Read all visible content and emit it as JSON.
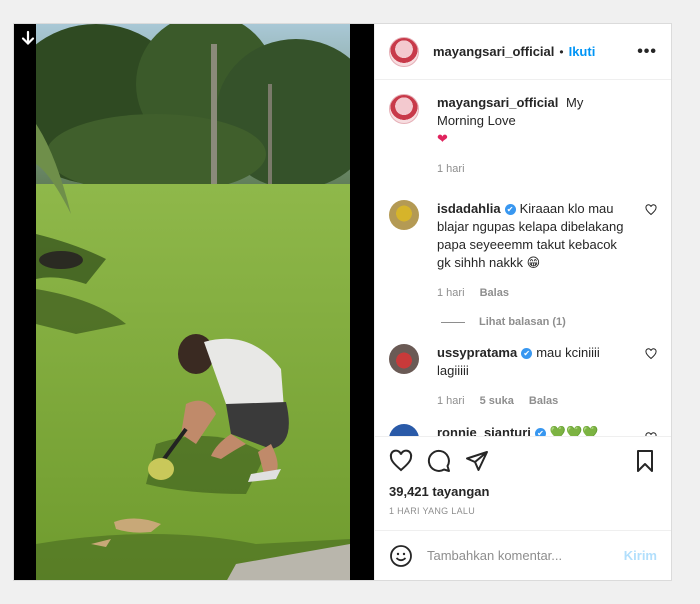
{
  "post": {
    "author": "mayangsari_official",
    "follow_label": "Ikuti",
    "separator": "•",
    "more_label": "•••",
    "caption": "My Morning Love",
    "caption_emoji": "❤",
    "caption_time": "1 hari"
  },
  "comments": [
    {
      "username": "isdadahlia",
      "verified": "✔",
      "text": "Kiraaan klo mau blajar ngupas kelapa dibelakang papa seyeeemm takut kebacok gk sihhh nakkk 😁",
      "time": "1 hari",
      "reply_label": "Balas",
      "view_replies": "Lihat balasan (1)"
    },
    {
      "username": "ussypratama",
      "verified": "✔",
      "text": "mau kciniiii lagiiiii",
      "time": "1 hari",
      "likes": "5 suka",
      "reply_label": "Balas"
    },
    {
      "username": "ronnie_sianturi",
      "verified": "✔",
      "text": "💚💚💚"
    }
  ],
  "stats": {
    "views": "39,421 tayangan",
    "date": "1 HARI YANG LALU"
  },
  "composer": {
    "placeholder": "Tambahkan komentar...",
    "post_label": "Kirim"
  },
  "icons": {
    "download": "arrow-down-icon",
    "like": "heart-icon",
    "comment": "comment-bubble-icon",
    "share": "paper-plane-icon",
    "save": "bookmark-icon",
    "emoji": "smiley-icon"
  },
  "colors": {
    "accent": "#0095f6",
    "verified": "#3897f0",
    "muted": "#8e8e8e",
    "heart": "#ed4956"
  }
}
